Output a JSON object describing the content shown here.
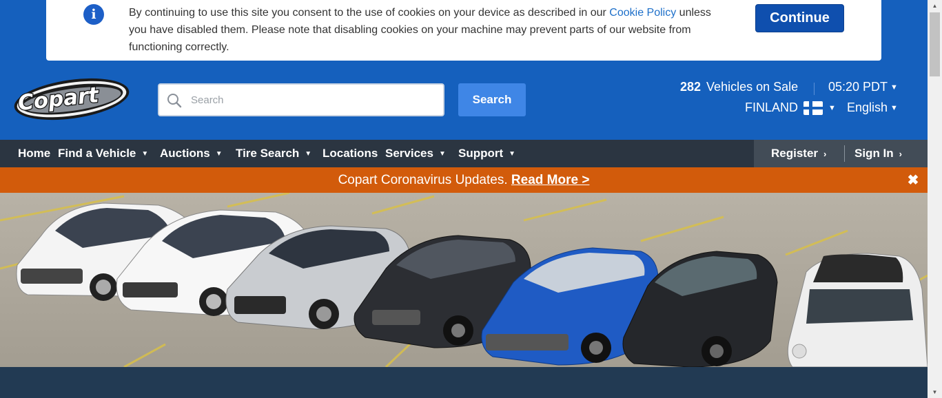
{
  "cookie_banner": {
    "text_before_link": "By continuing to use this site you consent to the use of cookies on your device as described in our ",
    "link_text": "Cookie Policy",
    "text_after_link": " unless you have disabled them. Please note that disabling cookies on your machine may prevent parts of our website from functioning correctly.",
    "continue_label": "Continue",
    "info_icon_glyph": "i"
  },
  "header": {
    "logo_text": "Copart",
    "search": {
      "placeholder": "Search",
      "value": "",
      "button_label": "Search"
    },
    "vehicles_count": "282",
    "vehicles_label": "Vehicles on Sale",
    "time": "05:20 PDT",
    "country": "FINLAND",
    "language": "English"
  },
  "nav": {
    "items": [
      {
        "label": "Home"
      },
      {
        "label": "Find a Vehicle"
      },
      {
        "label": "Auctions"
      },
      {
        "label": "Tire Search"
      },
      {
        "label": "Locations"
      },
      {
        "label": "Services"
      },
      {
        "label": "Support"
      }
    ],
    "register_label": "Register",
    "signin_label": "Sign In"
  },
  "alert": {
    "message": "Copart Coronavirus Updates. ",
    "link_text": "Read More >",
    "close_glyph": "✖"
  },
  "colors": {
    "brand_blue": "#1560bd",
    "nav_dark": "#2b3541",
    "alert_orange": "#d25b0b",
    "continue_blue": "#0f4fae",
    "search_button": "#3f86e6"
  }
}
